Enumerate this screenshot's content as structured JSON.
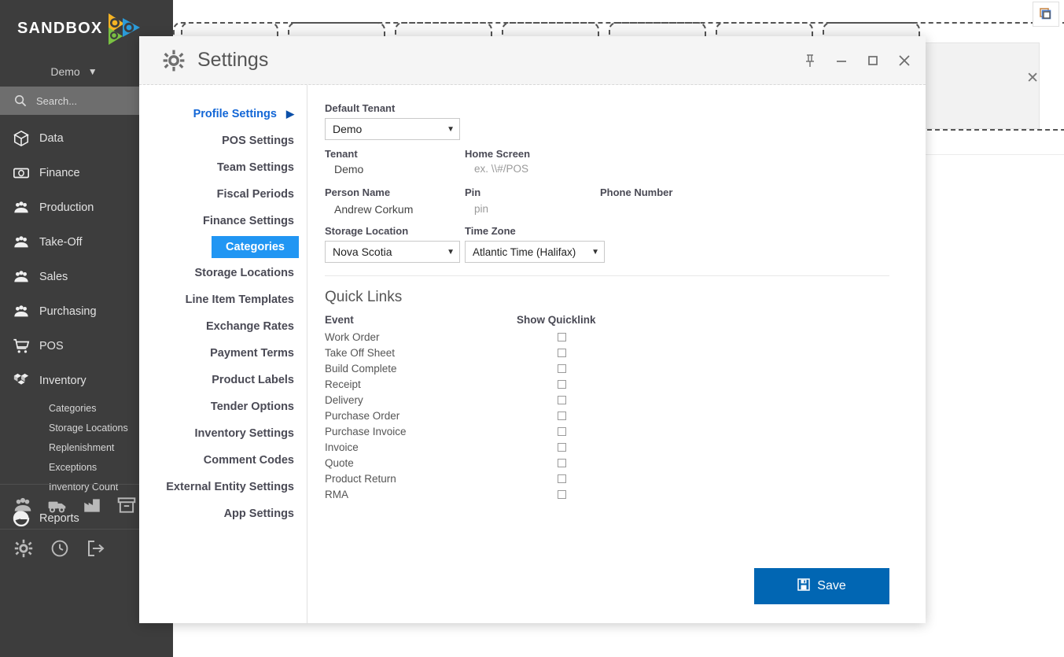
{
  "sidebar": {
    "logo_text": "SANDBOX",
    "logo_icon": "sandbox-gears-logo",
    "tenant_label": "Demo",
    "tenant_caret_icon": "chevron-down-icon",
    "search_placeholder": "Search...",
    "search_icon": "search-icon",
    "items": [
      {
        "label": "Data",
        "icon": "box-icon"
      },
      {
        "label": "Finance",
        "icon": "money-icon"
      },
      {
        "label": "Production",
        "icon": "people-icon"
      },
      {
        "label": "Take-Off",
        "icon": "people-icon"
      },
      {
        "label": "Sales",
        "icon": "people-icon"
      },
      {
        "label": "Purchasing",
        "icon": "people-icon"
      },
      {
        "label": "POS",
        "icon": "cart-icon"
      },
      {
        "label": "Inventory",
        "icon": "boxes-icon"
      }
    ],
    "sub_items": [
      {
        "label": "Categories"
      },
      {
        "label": "Storage Locations"
      },
      {
        "label": "Replenishment"
      },
      {
        "label": "Exceptions"
      },
      {
        "label": "Inventory Count"
      }
    ],
    "reports": {
      "label": "Reports",
      "icon": "pie-chart-icon"
    },
    "shortcut_icons": [
      {
        "icon": "people-icon"
      },
      {
        "icon": "truck-icon"
      },
      {
        "icon": "factory-icon"
      },
      {
        "icon": "archive-icon"
      }
    ],
    "footer_icons": [
      {
        "icon": "gear-icon"
      },
      {
        "icon": "clock-icon"
      },
      {
        "icon": "logout-icon"
      }
    ]
  },
  "background": {
    "restore_icon": "restore-windows-icon",
    "close_icon": "close-icon",
    "ghost_tab_count": 7
  },
  "dialog": {
    "title": "Settings",
    "title_icon": "gear-icon",
    "controls": [
      {
        "name": "pin",
        "icon": "pin-icon"
      },
      {
        "name": "minimize",
        "icon": "minimize-icon"
      },
      {
        "name": "maximize",
        "icon": "maximize-icon"
      },
      {
        "name": "close",
        "icon": "close-icon"
      }
    ],
    "nav": {
      "head": {
        "label": "Profile Settings",
        "arrow_icon": "triangle-right-icon"
      },
      "items": [
        {
          "label": "POS Settings",
          "selected": false
        },
        {
          "label": "Team Settings",
          "selected": false
        },
        {
          "label": "Fiscal Periods",
          "selected": false
        },
        {
          "label": "Finance Settings",
          "selected": false
        },
        {
          "label": "Categories",
          "selected": true
        },
        {
          "label": "Storage Locations",
          "selected": false
        },
        {
          "label": "Line Item Templates",
          "selected": false
        },
        {
          "label": "Exchange Rates",
          "selected": false
        },
        {
          "label": "Payment Terms",
          "selected": false
        },
        {
          "label": "Product Labels",
          "selected": false
        },
        {
          "label": "Tender Options",
          "selected": false
        },
        {
          "label": "Inventory Settings",
          "selected": false
        },
        {
          "label": "Comment Codes",
          "selected": false
        },
        {
          "label": "External Entity Settings",
          "selected": false
        },
        {
          "label": "App Settings",
          "selected": false
        }
      ]
    },
    "form": {
      "default_tenant_label": "Default Tenant",
      "default_tenant_value": "Demo",
      "tenant_label": "Tenant",
      "tenant_value": "Demo",
      "home_screen_label": "Home Screen",
      "home_screen_placeholder": "ex. \\\\#/POS",
      "person_name_label": "Person Name",
      "person_name_value": "Andrew Corkum",
      "pin_label": "Pin",
      "pin_placeholder": "pin",
      "phone_number_label": "Phone Number",
      "phone_number_value": "",
      "storage_location_label": "Storage Location",
      "storage_location_value": "Nova Scotia",
      "time_zone_label": "Time Zone",
      "time_zone_value": "Atlantic Time (Halifax)",
      "caret_icon": "caret-down-icon"
    },
    "quick_links": {
      "title": "Quick Links",
      "col_event": "Event",
      "col_show": "Show Quicklink",
      "rows": [
        {
          "event": "Work Order",
          "checked": false
        },
        {
          "event": "Take Off Sheet",
          "checked": false
        },
        {
          "event": "Build Complete",
          "checked": false
        },
        {
          "event": "Receipt",
          "checked": false
        },
        {
          "event": "Delivery",
          "checked": false
        },
        {
          "event": "Purchase Order",
          "checked": false
        },
        {
          "event": "Purchase Invoice",
          "checked": false
        },
        {
          "event": "Invoice",
          "checked": false
        },
        {
          "event": "Quote",
          "checked": false
        },
        {
          "event": "Product Return",
          "checked": false
        },
        {
          "event": "RMA",
          "checked": false
        }
      ]
    },
    "save": {
      "label": "Save",
      "icon": "save-disk-icon"
    }
  },
  "colors": {
    "sidebar_bg": "#3d3d3d",
    "search_bg": "#6e6e6e",
    "accent_blue": "#2196f3",
    "save_blue": "#0166b3",
    "link_blue": "#1266d6"
  }
}
